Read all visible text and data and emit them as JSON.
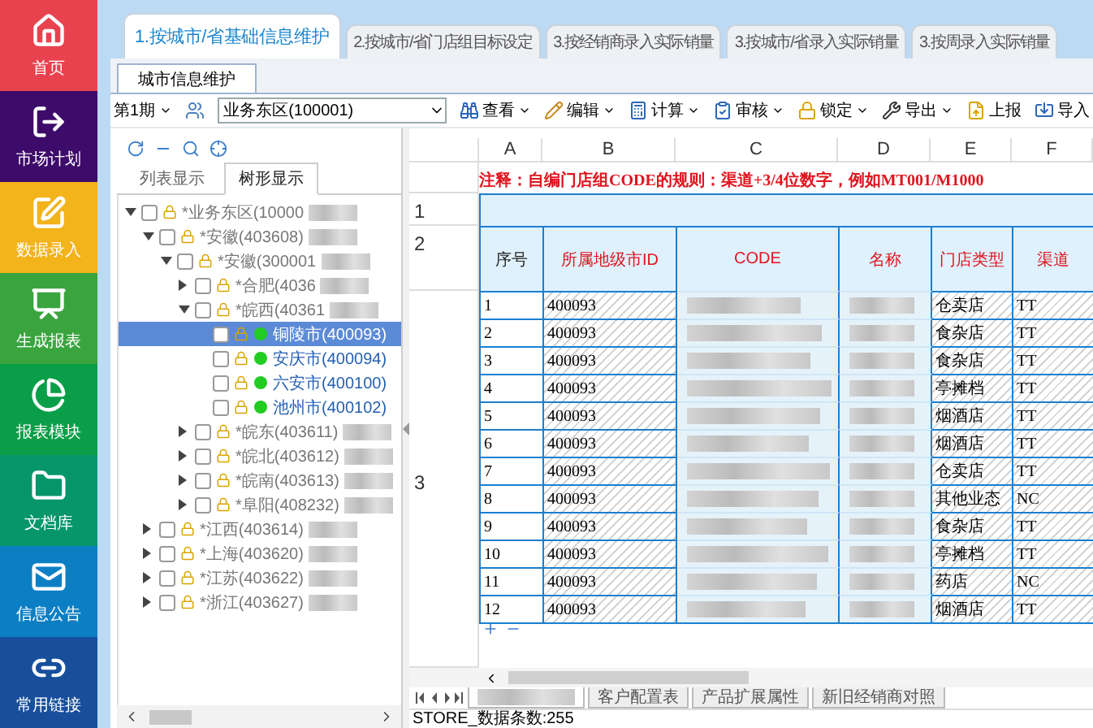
{
  "sidebar": {
    "items": [
      {
        "label": "首页",
        "color": "#e8424f"
      },
      {
        "label": "市场计划",
        "color": "#3d0b6a"
      },
      {
        "label": "数据录入",
        "color": "#f2b31b"
      },
      {
        "label": "生成报表",
        "color": "#3aa43f"
      },
      {
        "label": "报表模块",
        "color": "#0a9e48"
      },
      {
        "label": "文档库",
        "color": "#06966a"
      },
      {
        "label": "信息公告",
        "color": "#0c7fc4"
      },
      {
        "label": "常用链接",
        "color": "#174f9d"
      }
    ]
  },
  "top_tabs": [
    {
      "label": "1.按城市/省基础信息维护",
      "selected": true
    },
    {
      "label": "2.按城市/省门店组目标设定",
      "selected": false
    },
    {
      "label": "3.按经销商录入实际销量",
      "selected": false
    },
    {
      "label": "3.按城市/省录入实际销量",
      "selected": false
    },
    {
      "label": "3.按周录入实际销量",
      "selected": false
    }
  ],
  "sub_tab": {
    "label": "城市信息维护"
  },
  "toolbar": {
    "period": "第1期",
    "region_select": {
      "value": "业务东区(100001)"
    },
    "items": [
      {
        "label": "查看",
        "dropdown": true
      },
      {
        "label": "编辑",
        "dropdown": true
      },
      {
        "label": "计算",
        "dropdown": true
      },
      {
        "label": "审核",
        "dropdown": true
      },
      {
        "label": "锁定",
        "dropdown": true
      },
      {
        "label": "导出",
        "dropdown": true
      },
      {
        "label": "上报",
        "dropdown": false
      },
      {
        "label": "导入",
        "dropdown": false
      }
    ]
  },
  "left_panel": {
    "tabs": [
      {
        "label": "列表显示",
        "selected": false
      },
      {
        "label": "树形显示",
        "selected": true
      }
    ],
    "tree": [
      {
        "label": "*业务东区(10000",
        "kind": "branch",
        "expanded": true,
        "selected": false,
        "redacted": true,
        "children": [
          {
            "label": "*安徽(403608)",
            "kind": "branch",
            "expanded": true,
            "selected": false,
            "redacted": true,
            "children": [
              {
                "label": "*安徽(300001",
                "kind": "branch",
                "expanded": true,
                "selected": false,
                "redacted": true,
                "children": [
                  {
                    "label": "*合肥(4036",
                    "kind": "branch",
                    "expanded": false,
                    "selected": false,
                    "redacted": true
                  },
                  {
                    "label": "*皖西(40361",
                    "kind": "branch",
                    "expanded": true,
                    "selected": false,
                    "redacted": true,
                    "children": [
                      {
                        "label": "铜陵市(400093)",
                        "kind": "leaf",
                        "selected": true,
                        "redacted": false
                      },
                      {
                        "label": "安庆市(400094)",
                        "kind": "leaf",
                        "selected": false,
                        "redacted": false
                      },
                      {
                        "label": "六安市(400100)",
                        "kind": "leaf",
                        "selected": false,
                        "redacted": false
                      },
                      {
                        "label": "池州市(400102)",
                        "kind": "leaf",
                        "selected": false,
                        "redacted": false
                      }
                    ]
                  },
                  {
                    "label": "*皖东(403611)",
                    "kind": "branch",
                    "expanded": false,
                    "selected": false,
                    "redacted": true
                  },
                  {
                    "label": "*皖北(403612)",
                    "kind": "branch",
                    "expanded": false,
                    "selected": false,
                    "redacted": true
                  },
                  {
                    "label": "*皖南(403613)",
                    "kind": "branch",
                    "expanded": false,
                    "selected": false,
                    "redacted": true
                  },
                  {
                    "label": "*阜阳(408232)",
                    "kind": "branch",
                    "expanded": false,
                    "selected": false,
                    "redacted": true
                  }
                ]
              }
            ]
          },
          {
            "label": "*江西(403614)",
            "kind": "branch",
            "expanded": false,
            "selected": false,
            "redacted": true
          },
          {
            "label": "*上海(403620)",
            "kind": "branch",
            "expanded": false,
            "selected": false,
            "redacted": true
          },
          {
            "label": "*江苏(403622)",
            "kind": "branch",
            "expanded": false,
            "selected": false,
            "redacted": true
          },
          {
            "label": "*浙江(403627)",
            "kind": "branch",
            "expanded": false,
            "selected": false,
            "redacted": true
          }
        ]
      }
    ]
  },
  "sheet": {
    "column_letters": [
      "A",
      "B",
      "C",
      "D",
      "E",
      "F"
    ],
    "row_numbers": [
      "1",
      "2",
      "3"
    ],
    "note": "注释：自编门店组CODE的规则：渠道+3/4位数字，例如MT001/M1000",
    "headers": [
      {
        "label": "序号",
        "emphasized": false
      },
      {
        "label": "所属地级市ID",
        "emphasized": true
      },
      {
        "label": "CODE",
        "emphasized": true
      },
      {
        "label": "名称",
        "emphasized": true
      },
      {
        "label": "门店类型",
        "emphasized": true
      },
      {
        "label": "渠道",
        "emphasized": true
      }
    ],
    "rows": [
      {
        "no": "1",
        "city_id": "400093",
        "store_type": "仓卖店",
        "channel": "TT"
      },
      {
        "no": "2",
        "city_id": "400093",
        "store_type": "食杂店",
        "channel": "TT"
      },
      {
        "no": "3",
        "city_id": "400093",
        "store_type": "食杂店",
        "channel": "TT"
      },
      {
        "no": "4",
        "city_id": "400093",
        "store_type": "亭摊档",
        "channel": "TT"
      },
      {
        "no": "5",
        "city_id": "400093",
        "store_type": "烟酒店",
        "channel": "TT"
      },
      {
        "no": "6",
        "city_id": "400093",
        "store_type": "烟酒店",
        "channel": "TT"
      },
      {
        "no": "7",
        "city_id": "400093",
        "store_type": "仓卖店",
        "channel": "TT"
      },
      {
        "no": "8",
        "city_id": "400093",
        "store_type": "其他业态",
        "channel": "NC"
      },
      {
        "no": "9",
        "city_id": "400093",
        "store_type": "食杂店",
        "channel": "TT"
      },
      {
        "no": "10",
        "city_id": "400093",
        "store_type": "亭摊档",
        "channel": "TT"
      },
      {
        "no": "11",
        "city_id": "400093",
        "store_type": "药店",
        "channel": "NC"
      },
      {
        "no": "12",
        "city_id": "400093",
        "store_type": "烟酒店",
        "channel": "TT"
      }
    ],
    "sheet_tabs": [
      {
        "redacted": true,
        "selected": true
      },
      {
        "label": "客户配置表",
        "selected": false,
        "redacted": false
      },
      {
        "label": "产品扩展属性",
        "selected": false,
        "redacted": false
      },
      {
        "label": "新旧经销商对照",
        "selected": false,
        "redacted": false
      }
    ]
  },
  "status_bar": {
    "text": "STORE_数据条数:255"
  }
}
